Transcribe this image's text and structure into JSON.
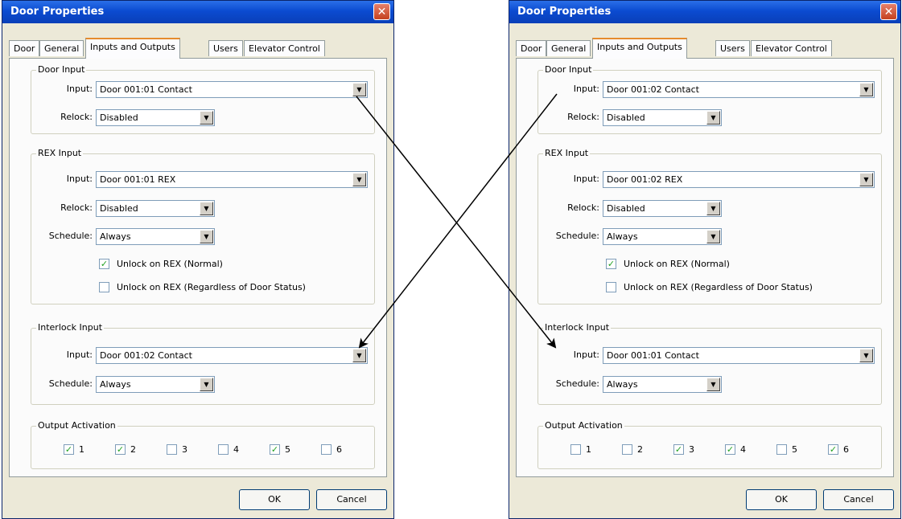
{
  "dialogs": [
    {
      "title": "Door Properties",
      "close_glyph": "✕",
      "tabs": [
        "Door",
        "General",
        "Inputs and Outputs",
        "Users",
        "Elevator Control"
      ],
      "active_tab": "Inputs and Outputs",
      "door_input": {
        "group": "Door Input",
        "input_label": "Input:",
        "input_value": "Door 001:01 Contact",
        "relock_label": "Relock:",
        "relock_value": "Disabled"
      },
      "rex_input": {
        "group": "REX Input",
        "input_label": "Input:",
        "input_value": "Door 001:01 REX",
        "relock_label": "Relock:",
        "relock_value": "Disabled",
        "schedule_label": "Schedule:",
        "schedule_value": "Always",
        "unlock_normal": "Unlock on REX (Normal)",
        "unlock_normal_checked": true,
        "unlock_regardless": "Unlock on REX (Regardless of Door Status)",
        "unlock_regardless_checked": false
      },
      "interlock_input": {
        "group": "Interlock Input",
        "input_label": "Input:",
        "input_value": "Door 001:02 Contact",
        "schedule_label": "Schedule:",
        "schedule_value": "Always"
      },
      "output_activation": {
        "group": "Output Activation",
        "outputs": [
          {
            "label": "1",
            "checked": true
          },
          {
            "label": "2",
            "checked": true
          },
          {
            "label": "3",
            "checked": false
          },
          {
            "label": "4",
            "checked": false
          },
          {
            "label": "5",
            "checked": true
          },
          {
            "label": "6",
            "checked": false
          }
        ]
      },
      "ok_label": "OK",
      "cancel_label": "Cancel"
    },
    {
      "title": "Door Properties",
      "close_glyph": "✕",
      "tabs": [
        "Door",
        "General",
        "Inputs and Outputs",
        "Users",
        "Elevator Control"
      ],
      "active_tab": "Inputs and Outputs",
      "door_input": {
        "group": "Door Input",
        "input_label": "Input:",
        "input_value": "Door 001:02 Contact",
        "relock_label": "Relock:",
        "relock_value": "Disabled"
      },
      "rex_input": {
        "group": "REX Input",
        "input_label": "Input:",
        "input_value": "Door 001:02 REX",
        "relock_label": "Relock:",
        "relock_value": "Disabled",
        "schedule_label": "Schedule:",
        "schedule_value": "Always",
        "unlock_normal": "Unlock on REX (Normal)",
        "unlock_normal_checked": true,
        "unlock_regardless": "Unlock on REX (Regardless of Door Status)",
        "unlock_regardless_checked": false
      },
      "interlock_input": {
        "group": "Interlock Input",
        "input_label": "Input:",
        "input_value": "Door 001:01 Contact",
        "schedule_label": "Schedule:",
        "schedule_value": "Always"
      },
      "output_activation": {
        "group": "Output Activation",
        "outputs": [
          {
            "label": "1",
            "checked": false
          },
          {
            "label": "2",
            "checked": false
          },
          {
            "label": "3",
            "checked": true
          },
          {
            "label": "4",
            "checked": true
          },
          {
            "label": "5",
            "checked": false
          },
          {
            "label": "6",
            "checked": true
          }
        ]
      },
      "ok_label": "OK",
      "cancel_label": "Cancel"
    }
  ],
  "colors": {
    "titlebar": "#0b4bd1",
    "dialog_bg": "#ece9d8",
    "arrow": "#000000"
  }
}
